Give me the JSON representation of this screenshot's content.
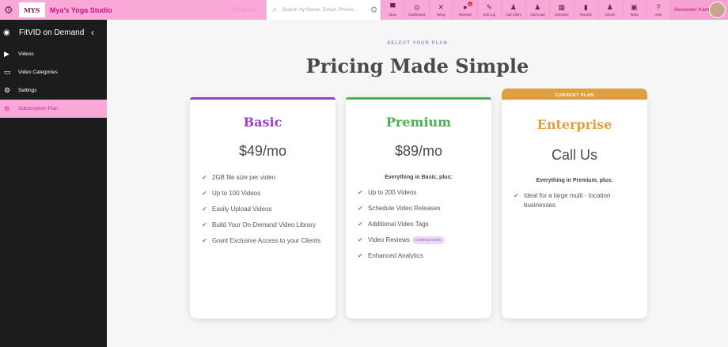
{
  "topbar": {
    "studio_name": "Mya's Yoga Studio",
    "logo_text": "MYS",
    "uid_placeholder": "UID search",
    "search_placeholder": "Search by Name, Email, Phone...",
    "nav": [
      {
        "label": "Store",
        "icon": "store-icon"
      },
      {
        "label": "Dashboard",
        "icon": "dashboard-icon"
      },
      {
        "label": "Setup",
        "icon": "tools-icon"
      },
      {
        "label": "Reviews",
        "icon": "reviews-icon",
        "badge": "5"
      },
      {
        "label": "Edit Log",
        "icon": "edit-log-icon"
      },
      {
        "label": "Add Client",
        "icon": "add-client-icon"
      },
      {
        "label": "Add Lead",
        "icon": "add-lead-icon"
      },
      {
        "label": "Schedule",
        "icon": "calendar-icon"
      },
      {
        "label": "Reports",
        "icon": "chart-icon"
      },
      {
        "label": "Clients",
        "icon": "clients-icon"
      },
      {
        "label": "Tasks",
        "icon": "tasks-icon"
      },
      {
        "label": "Help",
        "icon": "help-icon"
      }
    ],
    "user_name": "Alexander Kam"
  },
  "sidebar": {
    "title": "FitVID on Demand",
    "items": [
      {
        "label": "Videos",
        "icon": "video-icon"
      },
      {
        "label": "Video Categories",
        "icon": "categories-icon"
      },
      {
        "label": "Settings",
        "icon": "gear-icon"
      },
      {
        "label": "Subscription Plan",
        "icon": "subscription-icon",
        "active": true
      }
    ]
  },
  "main": {
    "eyebrow": "SELECT YOUR PLAN",
    "heading": "Pricing Made Simple",
    "current_banner": "CURRENT PLAN",
    "plans": [
      {
        "name": "Basic",
        "price": "$49/mo",
        "color": "#9b3fc7",
        "intro": "",
        "features": [
          "2GB file size per video",
          "Up to 100 Videos",
          "Easily Upload Videos",
          "Build Your On-Demand Video Library",
          "Grant Exclusive Access to your Clients"
        ]
      },
      {
        "name": "Premium",
        "price": "$89/mo",
        "color": "#4caf50",
        "intro": "Everything in Basic, plus:",
        "features": [
          "Up to 200 Videos",
          "Schedule Video Releases",
          "Additional Video Tags",
          "Video Reviews",
          "Enhanced Analytics"
        ],
        "coming_soon": "COMING SOON"
      },
      {
        "name": "Enterprise",
        "price": "Call Us",
        "color": "#dfa042",
        "intro": "Everything in Premium, plus:",
        "features": [
          "Ideal for a large multi - location businesses"
        ]
      }
    ]
  }
}
